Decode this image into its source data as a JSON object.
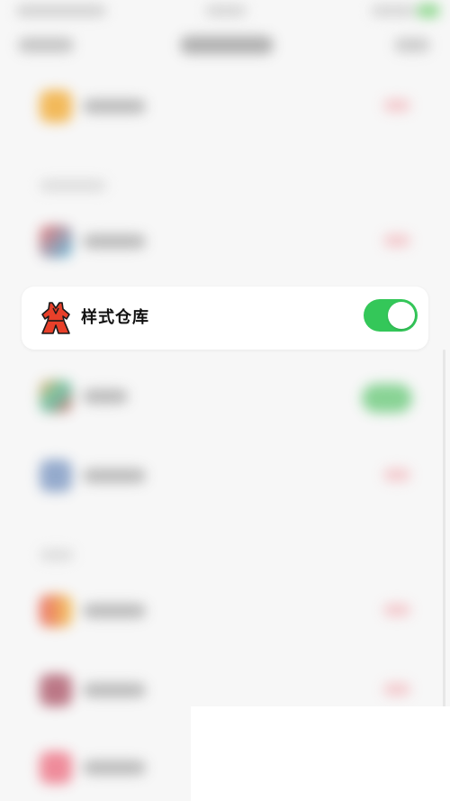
{
  "focused_row": {
    "icon": "dress-icon",
    "label": "样式仓库",
    "toggle_on": true
  },
  "colors": {
    "toggle_on": "#34c759",
    "dress_red": "#e8402a",
    "text": "#111111",
    "background": "#f7f7f7"
  }
}
